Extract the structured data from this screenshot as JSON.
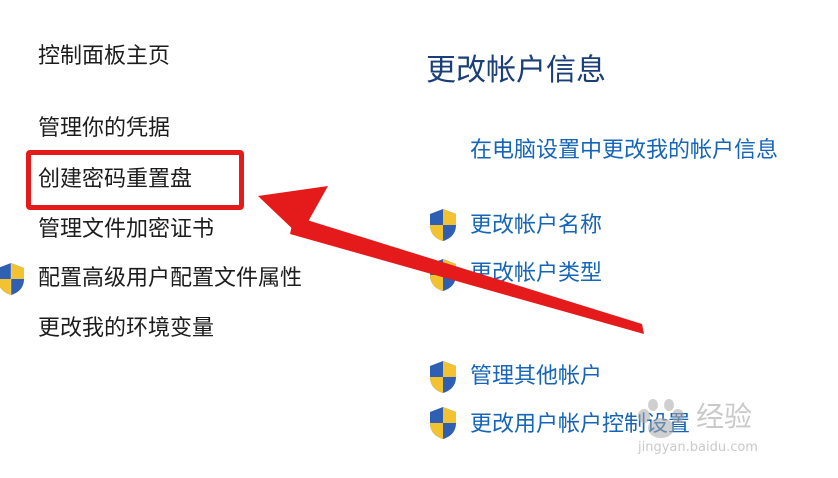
{
  "left_panel": {
    "items": [
      {
        "label": "控制面板主页",
        "shield": false
      },
      {
        "label": "管理你的凭据",
        "shield": false
      },
      {
        "label": "创建密码重置盘",
        "shield": false,
        "highlighted": true
      },
      {
        "label": "管理文件加密证书",
        "shield": false
      },
      {
        "label": "配置高级用户配置文件属性",
        "shield": true,
        "icon": "uac-shield-icon"
      },
      {
        "label": "更改我的环境变量",
        "shield": false
      }
    ]
  },
  "main": {
    "heading": "更改帐户信息",
    "links": [
      {
        "label": "在电脑设置中更改我的帐户信息",
        "shield": false
      },
      {
        "label": "更改帐户名称",
        "shield": true,
        "icon": "uac-shield-icon"
      },
      {
        "label": "更改帐户类型",
        "shield": true,
        "icon": "uac-shield-icon"
      },
      {
        "label": "管理其他帐户",
        "shield": true,
        "icon": "uac-shield-icon"
      },
      {
        "label": "更改用户帐户控制设置",
        "shield": true,
        "icon": "uac-shield-icon"
      }
    ]
  },
  "annotation": {
    "highlight_color": "#e51a1a",
    "arrow_color": "#e51a1a",
    "arrow_points_to": "创建密码重置盘"
  },
  "watermark": {
    "text": "经验",
    "url": "jingyan.baidu.com"
  },
  "colors": {
    "heading": "#1a3e78",
    "link": "#1565b8",
    "left_text": "#1c1c1c",
    "background": "#ffffff"
  }
}
